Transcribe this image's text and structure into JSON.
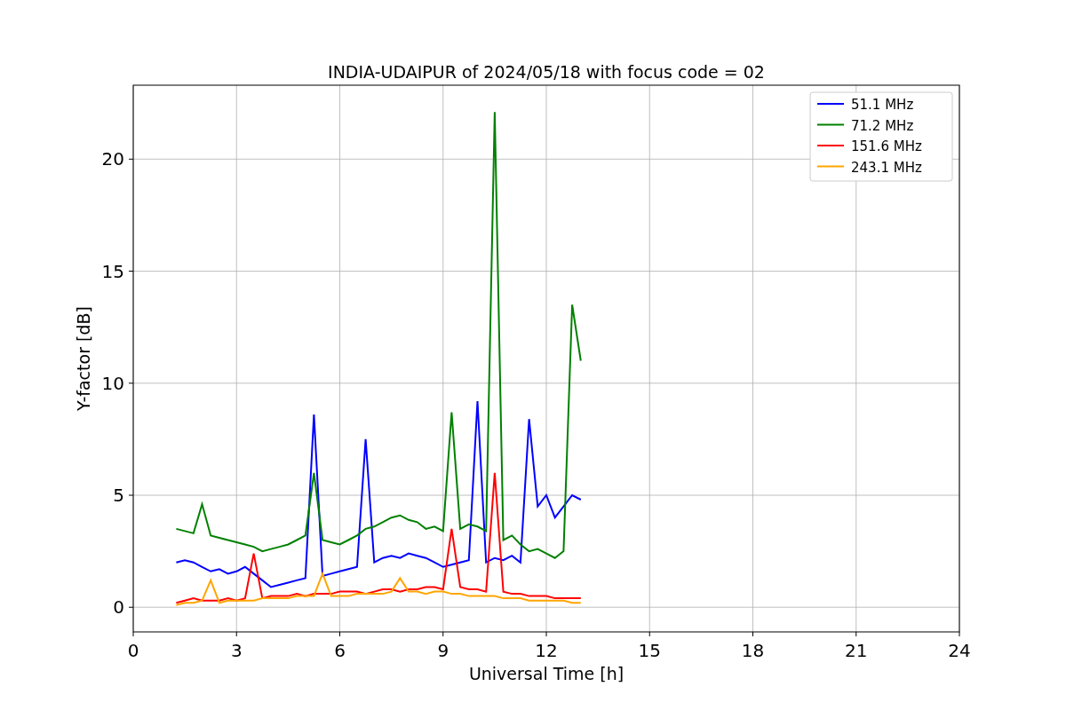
{
  "figure": {
    "chart_data": {
      "type": "line",
      "title": "INDIA-UDAIPUR of 2024/05/18 with focus code = 02",
      "xlabel": "Universal Time [h]",
      "ylabel": "Y-factor [dB]",
      "x": [
        1.25,
        1.5,
        1.75,
        2.0,
        2.25,
        2.5,
        2.75,
        3.0,
        3.25,
        3.5,
        3.75,
        4.0,
        4.25,
        4.5,
        4.75,
        5.0,
        5.25,
        5.5,
        5.75,
        6.0,
        6.25,
        6.5,
        6.75,
        7.0,
        7.25,
        7.5,
        7.75,
        8.0,
        8.25,
        8.5,
        8.75,
        9.0,
        9.25,
        9.5,
        9.75,
        10.0,
        10.25,
        10.5,
        10.75,
        11.0,
        11.25,
        11.5,
        11.75,
        12.0,
        12.25,
        12.5,
        12.75,
        13.0
      ],
      "series": [
        {
          "name": "51.1 MHz",
          "color": "#0000ff",
          "values": [
            2.0,
            2.1,
            2.0,
            1.8,
            1.6,
            1.7,
            1.5,
            1.6,
            1.8,
            1.5,
            1.2,
            0.9,
            1.0,
            1.1,
            1.2,
            1.3,
            8.6,
            1.4,
            1.5,
            1.6,
            1.7,
            1.8,
            7.5,
            2.0,
            2.2,
            2.3,
            2.2,
            2.4,
            2.3,
            2.2,
            2.0,
            1.8,
            1.9,
            2.0,
            2.1,
            9.2,
            2.0,
            2.2,
            2.1,
            2.3,
            2.0,
            8.4,
            4.5,
            5.0,
            4.0,
            4.5,
            5.0,
            4.8
          ]
        },
        {
          "name": "71.2 MHz",
          "color": "#008000",
          "values": [
            3.5,
            3.4,
            3.3,
            4.6,
            3.2,
            3.1,
            3.0,
            2.9,
            2.8,
            2.7,
            2.5,
            2.6,
            2.7,
            2.8,
            3.0,
            3.2,
            6.0,
            3.0,
            2.9,
            2.8,
            3.0,
            3.2,
            3.5,
            3.6,
            3.8,
            4.0,
            4.1,
            3.9,
            3.8,
            3.5,
            3.6,
            3.4,
            8.7,
            3.5,
            3.7,
            3.6,
            3.4,
            22.1,
            3.0,
            3.2,
            2.8,
            2.5,
            2.6,
            2.4,
            2.2,
            2.5,
            13.5,
            11.0
          ]
        },
        {
          "name": "151.6 MHz",
          "color": "#ff0000",
          "values": [
            0.2,
            0.3,
            0.4,
            0.3,
            0.3,
            0.3,
            0.4,
            0.3,
            0.4,
            2.4,
            0.4,
            0.5,
            0.5,
            0.5,
            0.6,
            0.5,
            0.6,
            0.6,
            0.6,
            0.7,
            0.7,
            0.7,
            0.6,
            0.7,
            0.8,
            0.8,
            0.7,
            0.8,
            0.8,
            0.9,
            0.9,
            0.8,
            3.5,
            0.9,
            0.8,
            0.8,
            0.7,
            6.0,
            0.7,
            0.6,
            0.6,
            0.5,
            0.5,
            0.5,
            0.4,
            0.4,
            0.4,
            0.4
          ]
        },
        {
          "name": "243.1 MHz",
          "color": "#ffa500",
          "values": [
            0.1,
            0.2,
            0.2,
            0.3,
            1.2,
            0.2,
            0.3,
            0.3,
            0.3,
            0.3,
            0.4,
            0.4,
            0.4,
            0.4,
            0.5,
            0.5,
            0.5,
            1.5,
            0.5,
            0.5,
            0.5,
            0.6,
            0.6,
            0.6,
            0.6,
            0.7,
            1.3,
            0.7,
            0.7,
            0.6,
            0.7,
            0.7,
            0.6,
            0.6,
            0.5,
            0.5,
            0.5,
            0.5,
            0.4,
            0.4,
            0.4,
            0.3,
            0.3,
            0.3,
            0.3,
            0.3,
            0.2,
            0.2
          ]
        }
      ],
      "grid": true,
      "legend": true,
      "xlim": [
        0,
        24
      ],
      "ylim": [
        -1.1,
        23.3
      ],
      "xticks": [
        0,
        3,
        6,
        9,
        12,
        15,
        18,
        21,
        24
      ],
      "yticks": [
        0,
        5,
        10,
        15,
        20
      ]
    }
  }
}
